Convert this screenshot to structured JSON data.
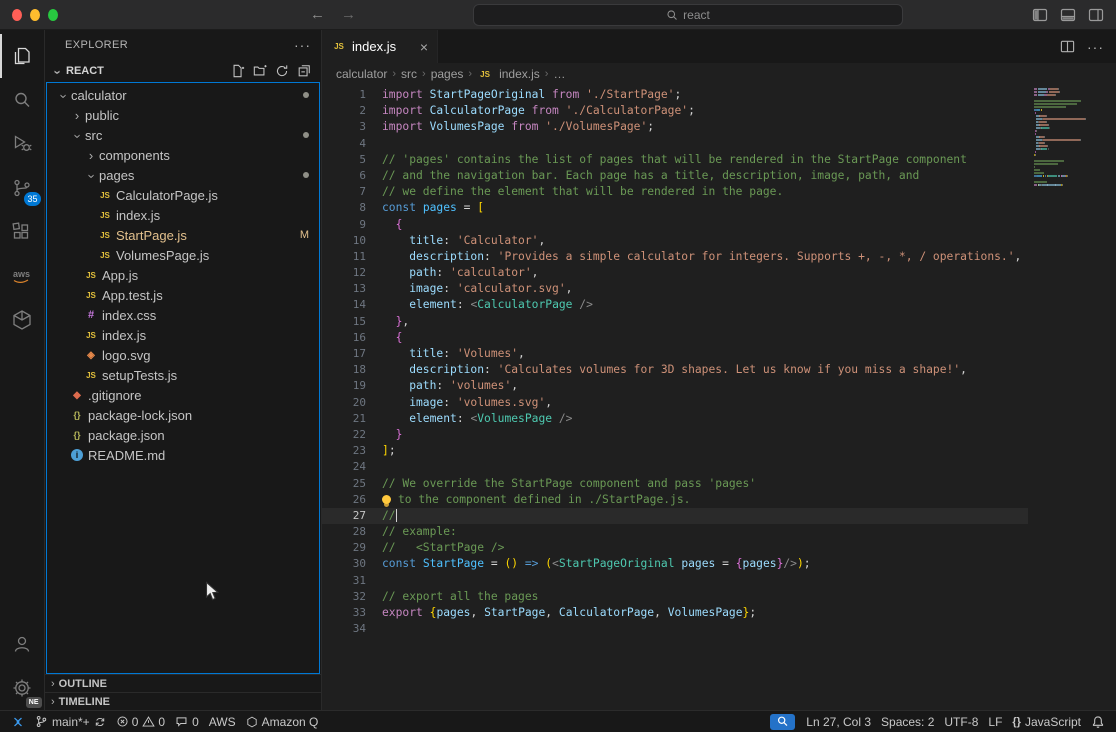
{
  "title_bar": {
    "search_text": "react"
  },
  "activity_bar": {
    "items": [
      {
        "id": "explorer",
        "active": true
      },
      {
        "id": "search"
      },
      {
        "id": "run-debug"
      },
      {
        "id": "source-control",
        "badge": "35"
      },
      {
        "id": "extensions"
      },
      {
        "id": "aws"
      },
      {
        "id": "amazon-q"
      }
    ],
    "bottom": [
      {
        "id": "accounts"
      },
      {
        "id": "settings",
        "badge": "NE"
      }
    ]
  },
  "sidebar": {
    "title": "EXPLORER",
    "section": "REACT",
    "outline_label": "OUTLINE",
    "timeline_label": "TIMELINE",
    "tree": [
      {
        "label": "calculator",
        "depth": 0,
        "type": "folder",
        "expanded": true,
        "dot": true
      },
      {
        "label": "public",
        "depth": 1,
        "type": "folder",
        "expanded": false
      },
      {
        "label": "src",
        "depth": 1,
        "type": "folder",
        "expanded": true,
        "dot": true
      },
      {
        "label": "components",
        "depth": 2,
        "type": "folder",
        "expanded": false
      },
      {
        "label": "pages",
        "depth": 2,
        "type": "folder",
        "expanded": true,
        "dot": true
      },
      {
        "label": "CalculatorPage.js",
        "depth": 3,
        "type": "js"
      },
      {
        "label": "index.js",
        "depth": 3,
        "type": "js"
      },
      {
        "label": "StartPage.js",
        "depth": 3,
        "type": "js",
        "git": "M"
      },
      {
        "label": "VolumesPage.js",
        "depth": 3,
        "type": "js"
      },
      {
        "label": "App.js",
        "depth": 2,
        "type": "js"
      },
      {
        "label": "App.test.js",
        "depth": 2,
        "type": "js"
      },
      {
        "label": "index.css",
        "depth": 2,
        "type": "css"
      },
      {
        "label": "index.js",
        "depth": 2,
        "type": "js"
      },
      {
        "label": "logo.svg",
        "depth": 2,
        "type": "svg"
      },
      {
        "label": "setupTests.js",
        "depth": 2,
        "type": "js"
      },
      {
        "label": ".gitignore",
        "depth": 1,
        "type": "git"
      },
      {
        "label": "package-lock.json",
        "depth": 1,
        "type": "json"
      },
      {
        "label": "package.json",
        "depth": 1,
        "type": "json"
      },
      {
        "label": "README.md",
        "depth": 1,
        "type": "md"
      }
    ]
  },
  "tab": {
    "label": "index.js"
  },
  "breadcrumbs": {
    "items": [
      "calculator",
      "src",
      "pages",
      "index.js",
      "…"
    ]
  },
  "editor": {
    "cursor_line": 27,
    "lines": [
      {
        "n": 1,
        "s": [
          [
            "k",
            "import"
          ],
          [
            "v",
            " StartPageOriginal"
          ],
          [
            "k",
            " from"
          ],
          [
            "s",
            " './StartPage'"
          ],
          [
            "p",
            ";"
          ]
        ]
      },
      {
        "n": 2,
        "s": [
          [
            "k",
            "import"
          ],
          [
            "v",
            " CalculatorPage"
          ],
          [
            "k",
            " from"
          ],
          [
            "s",
            " './CalculatorPage'"
          ],
          [
            "p",
            ";"
          ]
        ]
      },
      {
        "n": 3,
        "s": [
          [
            "k",
            "import"
          ],
          [
            "v",
            " VolumesPage"
          ],
          [
            "k",
            " from"
          ],
          [
            "s",
            " './VolumesPage'"
          ],
          [
            "p",
            ";"
          ]
        ]
      },
      {
        "n": 4,
        "s": []
      },
      {
        "n": 5,
        "s": [
          [
            "m",
            "// 'pages' contains the list of pages that will be rendered in the StartPage component"
          ]
        ]
      },
      {
        "n": 6,
        "s": [
          [
            "m",
            "// and the navigation bar. Each page has a title, description, image, path, and"
          ]
        ]
      },
      {
        "n": 7,
        "s": [
          [
            "m",
            "// we define the element that will be rendered in the page."
          ]
        ]
      },
      {
        "n": 8,
        "s": [
          [
            "c",
            "const"
          ],
          [
            "d",
            " pages"
          ],
          [
            "p",
            " = "
          ],
          [
            "b1",
            "["
          ]
        ]
      },
      {
        "n": 9,
        "s": [
          [
            "p",
            "  "
          ],
          [
            "b2",
            "{"
          ]
        ]
      },
      {
        "n": 10,
        "s": [
          [
            "a",
            "    title"
          ],
          [
            "p",
            ": "
          ],
          [
            "s",
            "'Calculator'"
          ],
          [
            "p",
            ","
          ]
        ]
      },
      {
        "n": 11,
        "s": [
          [
            "a",
            "    description"
          ],
          [
            "p",
            ": "
          ],
          [
            "s",
            "'Provides a simple calculator for integers. Supports +, -, *, / operations.'"
          ],
          [
            "p",
            ","
          ]
        ]
      },
      {
        "n": 12,
        "s": [
          [
            "a",
            "    path"
          ],
          [
            "p",
            ": "
          ],
          [
            "s",
            "'calculator'"
          ],
          [
            "p",
            ","
          ]
        ]
      },
      {
        "n": 13,
        "s": [
          [
            "a",
            "    image"
          ],
          [
            "p",
            ": "
          ],
          [
            "s",
            "'calculator.svg'"
          ],
          [
            "p",
            ","
          ]
        ]
      },
      {
        "n": 14,
        "s": [
          [
            "a",
            "    element"
          ],
          [
            "p",
            ": "
          ],
          [
            "g",
            "<"
          ],
          [
            "t",
            "CalculatorPage"
          ],
          [
            "g",
            " />"
          ]
        ]
      },
      {
        "n": 15,
        "s": [
          [
            "p",
            "  "
          ],
          [
            "b2",
            "}"
          ],
          [
            "p",
            ","
          ]
        ]
      },
      {
        "n": 16,
        "s": [
          [
            "p",
            "  "
          ],
          [
            "b2",
            "{"
          ]
        ]
      },
      {
        "n": 17,
        "s": [
          [
            "a",
            "    title"
          ],
          [
            "p",
            ": "
          ],
          [
            "s",
            "'Volumes'"
          ],
          [
            "p",
            ","
          ]
        ]
      },
      {
        "n": 18,
        "s": [
          [
            "a",
            "    description"
          ],
          [
            "p",
            ": "
          ],
          [
            "s",
            "'Calculates volumes for 3D shapes. Let us know if you miss a shape!'"
          ],
          [
            "p",
            ","
          ]
        ]
      },
      {
        "n": 19,
        "s": [
          [
            "a",
            "    path"
          ],
          [
            "p",
            ": "
          ],
          [
            "s",
            "'volumes'"
          ],
          [
            "p",
            ","
          ]
        ]
      },
      {
        "n": 20,
        "s": [
          [
            "a",
            "    image"
          ],
          [
            "p",
            ": "
          ],
          [
            "s",
            "'volumes.svg'"
          ],
          [
            "p",
            ","
          ]
        ]
      },
      {
        "n": 21,
        "s": [
          [
            "a",
            "    element"
          ],
          [
            "p",
            ": "
          ],
          [
            "g",
            "<"
          ],
          [
            "t",
            "VolumesPage"
          ],
          [
            "g",
            " />"
          ]
        ]
      },
      {
        "n": 22,
        "s": [
          [
            "p",
            "  "
          ],
          [
            "b2",
            "}"
          ]
        ]
      },
      {
        "n": 23,
        "s": [
          [
            "b1",
            "]"
          ],
          [
            "p",
            ";"
          ]
        ]
      },
      {
        "n": 24,
        "s": []
      },
      {
        "n": 25,
        "s": [
          [
            "m",
            "// We override the StartPage component and pass 'pages'"
          ]
        ]
      },
      {
        "n": 26,
        "s": [
          [
            "lb",
            ""
          ],
          [
            "m",
            "to the component defined in ./StartPage.js."
          ]
        ]
      },
      {
        "n": 27,
        "s": [
          [
            "m",
            "//"
          ]
        ]
      },
      {
        "n": 28,
        "s": [
          [
            "m",
            "// example:"
          ]
        ]
      },
      {
        "n": 29,
        "s": [
          [
            "m",
            "//   <StartPage />"
          ]
        ]
      },
      {
        "n": 30,
        "s": [
          [
            "c",
            "const"
          ],
          [
            "d",
            " StartPage"
          ],
          [
            "p",
            " = "
          ],
          [
            "b1",
            "()"
          ],
          [
            "c",
            " =>"
          ],
          [
            "p",
            " "
          ],
          [
            "b1",
            "("
          ],
          [
            "g",
            "<"
          ],
          [
            "t",
            "StartPageOriginal"
          ],
          [
            "a",
            " pages"
          ],
          [
            "p",
            " = "
          ],
          [
            "b2",
            "{"
          ],
          [
            "v",
            "pages"
          ],
          [
            "b2",
            "}"
          ],
          [
            "g",
            "/>"
          ],
          [
            "b1",
            ")"
          ],
          [
            "p",
            ";"
          ]
        ]
      },
      {
        "n": 31,
        "s": []
      },
      {
        "n": 32,
        "s": [
          [
            "m",
            "// export all the pages"
          ]
        ]
      },
      {
        "n": 33,
        "s": [
          [
            "k",
            "export"
          ],
          [
            "p",
            " "
          ],
          [
            "b1",
            "{"
          ],
          [
            "v",
            "pages"
          ],
          [
            "p",
            ", "
          ],
          [
            "v",
            "StartPage"
          ],
          [
            "p",
            ", "
          ],
          [
            "v",
            "CalculatorPage"
          ],
          [
            "p",
            ", "
          ],
          [
            "v",
            "VolumesPage"
          ],
          [
            "b1",
            "}"
          ],
          [
            "p",
            ";"
          ]
        ]
      },
      {
        "n": 34,
        "s": []
      }
    ]
  },
  "status_bar": {
    "left": [
      {
        "id": "remote"
      },
      {
        "id": "branch",
        "label": "main*+"
      },
      {
        "id": "problems",
        "errors": "0",
        "warnings": "0"
      },
      {
        "id": "counter",
        "label": "0"
      },
      {
        "id": "aws",
        "label": "AWS"
      },
      {
        "id": "amazon-q",
        "label": "Amazon Q"
      }
    ],
    "right": [
      {
        "id": "zoom"
      },
      {
        "id": "cursor-position",
        "label": "Ln 27, Col 3"
      },
      {
        "id": "indentation",
        "label": "Spaces: 2"
      },
      {
        "id": "encoding",
        "label": "UTF-8"
      },
      {
        "id": "eol",
        "label": "LF"
      },
      {
        "id": "language",
        "label": "JavaScript"
      }
    ]
  }
}
